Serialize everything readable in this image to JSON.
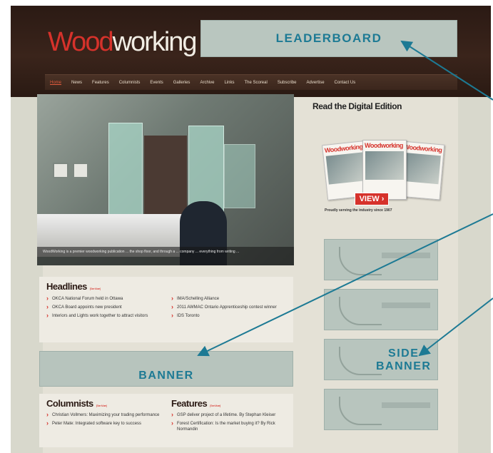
{
  "site": {
    "logo_part1": "Wood",
    "logo_part2": "working"
  },
  "ads": {
    "leaderboard": "LEADERBOARD",
    "banner": "BANNER",
    "side_banner_line1": "SIDE",
    "side_banner_line2": "BANNER"
  },
  "nav": {
    "items": [
      "Home",
      "News",
      "Features",
      "Columnists",
      "Events",
      "Galleries",
      "Archive",
      "Links",
      "The Scoreal",
      "Subscribe",
      "Advertise",
      "Contact Us"
    ]
  },
  "hero": {
    "caption": "WoodWorking is a premier woodworking publication ... the shop floor, and through a ... company ... everything from writing ..."
  },
  "headlines": {
    "title": "Headlines",
    "more": "[See More]",
    "left": [
      "OKCA National Forum held in Ottawa",
      "OKCA Board appoints new president",
      "Interiors and Lights work together to attract visitors"
    ],
    "right": [
      "IMA/Schelling Alliance",
      "2011 AWMAC Ontario Apprenticeship contest winner",
      "IDS Toronto"
    ]
  },
  "bottom": {
    "columnists_title": "Columnists",
    "columnists_more": "[See More]",
    "columnists": [
      "Christian Vollmers: Maximizing your trading performance",
      "Peter Mate: Integrated software key to success"
    ],
    "features_title": "Features",
    "features_more": "[See More]",
    "features": [
      "GSP deliver project of a lifetime. By Stephan Kleiser",
      "Forest Certification: Is the market buying it? By Rick Normandin"
    ]
  },
  "digital": {
    "title": "Read the Digital Edition",
    "mag_title": "Woodworking",
    "view": "VIEW ›",
    "proudly": "Proudly serving the industry since 1907"
  },
  "colors": {
    "accent": "#1d7a94",
    "brand_red": "#d6322b",
    "header_bg": "#2b1a14"
  }
}
